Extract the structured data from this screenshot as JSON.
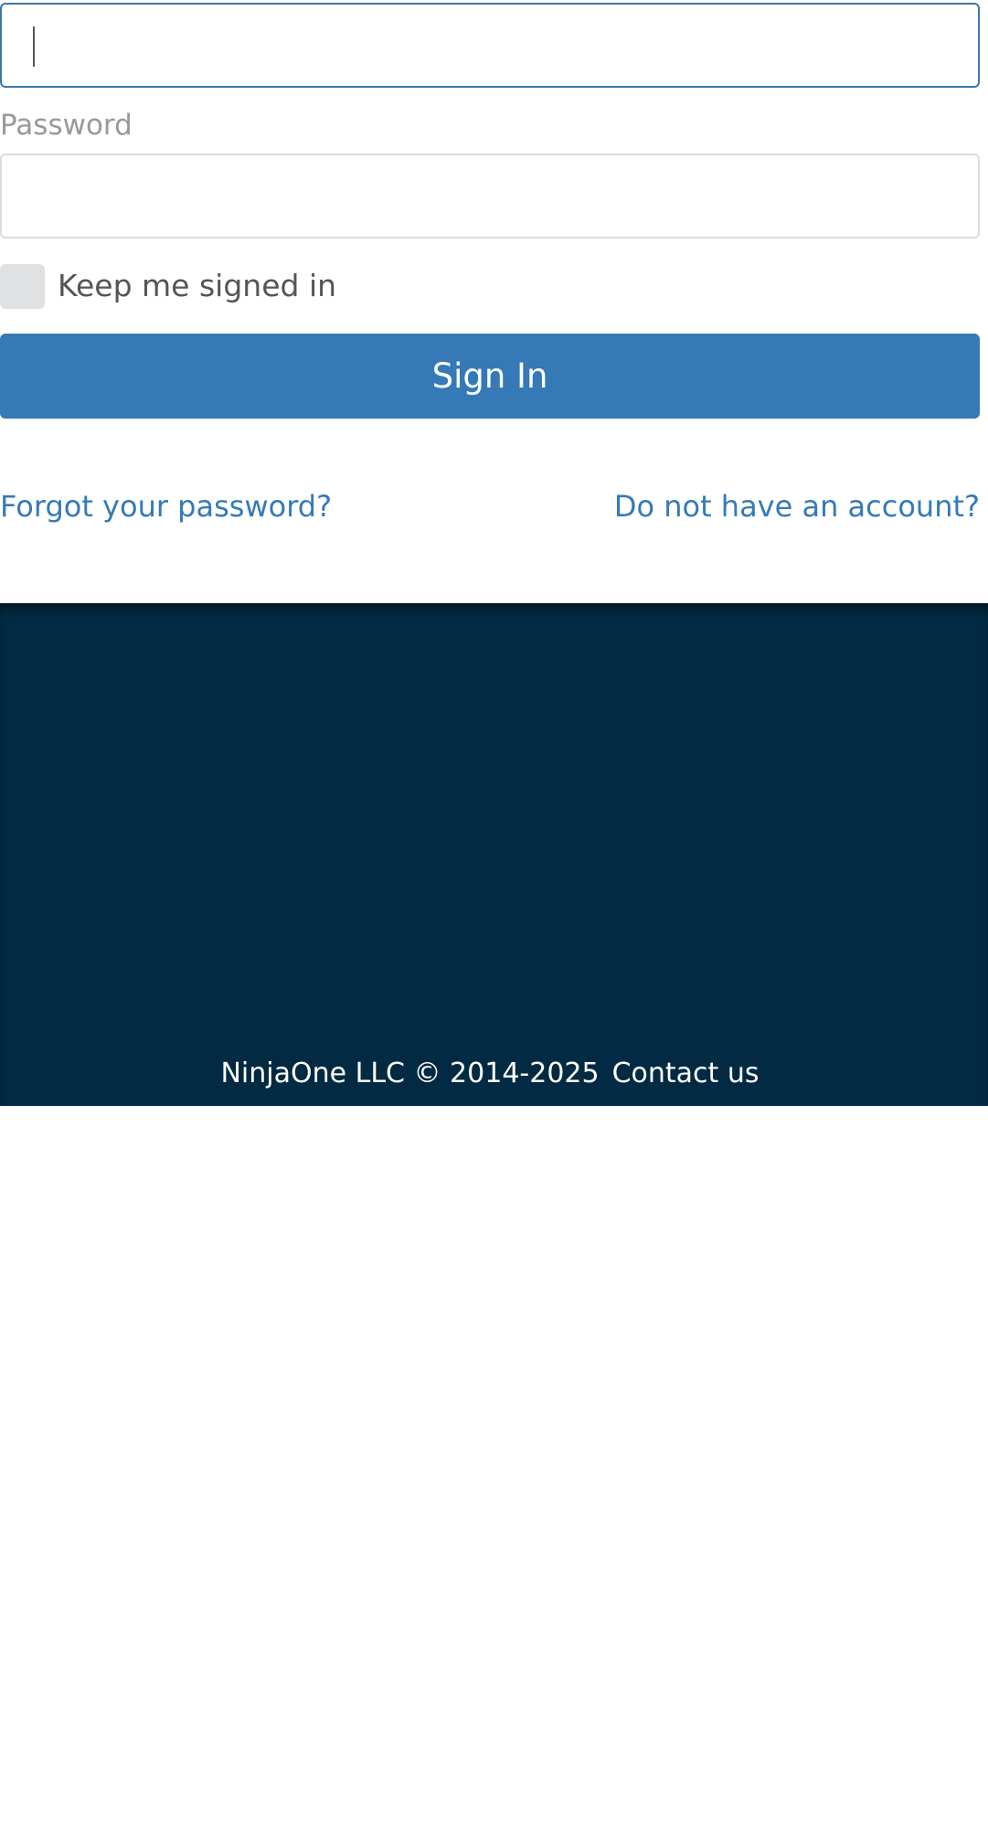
{
  "login_form": {
    "username_field": {
      "value": "",
      "focused": true
    },
    "password_label": "Password",
    "password_field": {
      "value": ""
    },
    "remember_me_label": "Keep me signed in",
    "remember_me_checked": false,
    "sign_in_label": "Sign In",
    "forgot_password_link": "Forgot your password?",
    "no_account_link": "Do not have an account?"
  },
  "footer": {
    "copyright": "NinjaOne LLC © 2014-2025",
    "contact_link": "Contact us"
  },
  "colors": {
    "accent": "#357ab7",
    "footer_background": "#022a42",
    "focus_border": "#3a76b0"
  }
}
